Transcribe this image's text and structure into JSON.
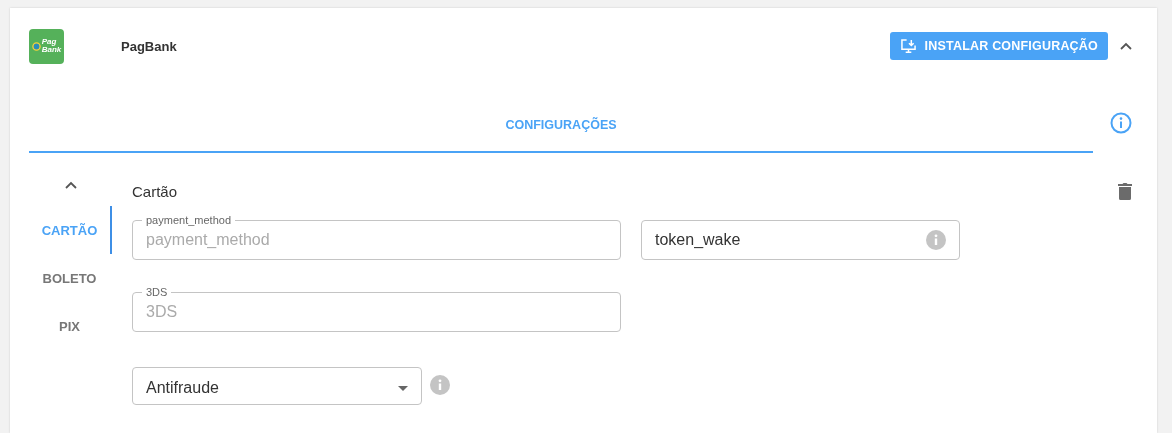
{
  "header": {
    "logo_text": [
      "Pag",
      "Bank"
    ],
    "title": "PagBank",
    "install_button": "INSTALAR CONFIGURAÇÃO",
    "expanded": true
  },
  "tabs": [
    {
      "label": "CONFIGURAÇÕES",
      "selected": true
    }
  ],
  "sections": [
    {
      "label": "CARTÃO",
      "selected": true
    },
    {
      "label": "BOLETO",
      "selected": false
    },
    {
      "label": "PIX",
      "selected": false
    }
  ],
  "section_title": "Cartão",
  "fields": [
    {
      "kind": "text",
      "label": "payment_method",
      "placeholder": "payment_method",
      "info": false
    },
    {
      "kind": "text",
      "value": "token_wake",
      "info": true
    },
    {
      "kind": "text",
      "label": "3DS",
      "placeholder": "3DS",
      "info": false
    },
    {
      "kind": "select",
      "value": "Antifraude",
      "info": true
    }
  ]
}
